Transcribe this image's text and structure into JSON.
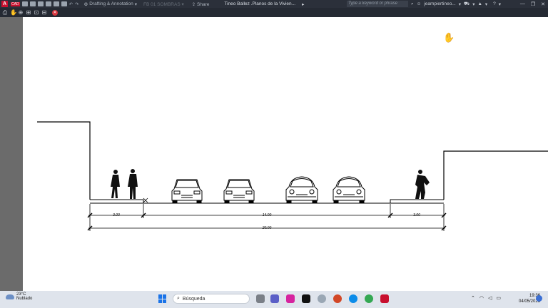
{
  "titlebar": {
    "app_letter": "A",
    "app_badge": "CAD",
    "workspace": "Drafting & Annotation",
    "layer": "FB 01 SOMBRAS",
    "share": "Share",
    "document_title": "Tineo Ballez .Planos de la Vivien...",
    "search_placeholder": "Type a keyword or phrase",
    "user": "jeampiertineo...",
    "help": "?"
  },
  "drawing": {
    "dimensions": {
      "left_sidewalk": "3.00",
      "roadway": "14.00",
      "right_sidewalk": "3.00",
      "total": "20.00"
    }
  },
  "taskbar": {
    "weather_temp": "23°C",
    "weather_desc": "Nublado",
    "search_label": "Búsqueda",
    "time": "19:36",
    "date": "04/05/2023"
  },
  "colors": {
    "accent": "#c8102e",
    "start_blue": "#1a73e8"
  }
}
